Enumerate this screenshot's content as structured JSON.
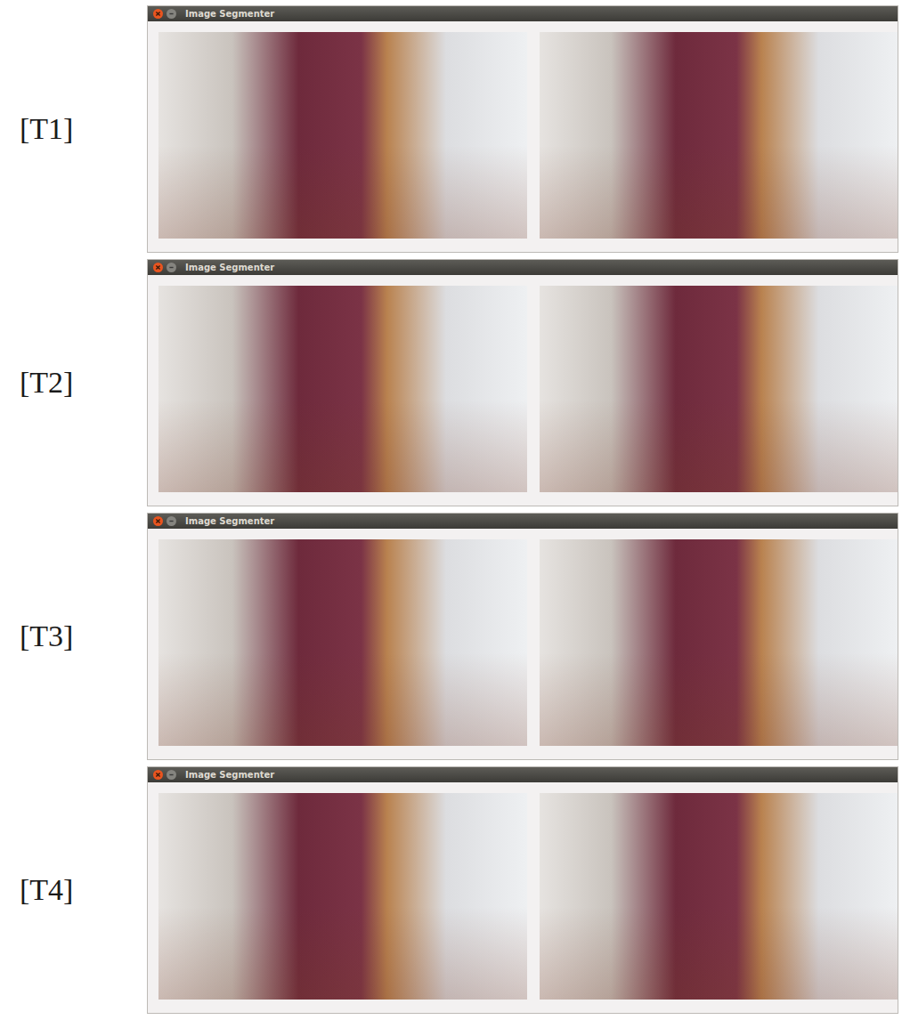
{
  "rows": [
    {
      "label": "[T1]",
      "window_title": "Image Segmenter"
    },
    {
      "label": "[T2]",
      "window_title": "Image Segmenter"
    },
    {
      "label": "[T3]",
      "window_title": "Image Segmenter"
    },
    {
      "label": "[T4]",
      "window_title": "Image Segmenter"
    }
  ]
}
